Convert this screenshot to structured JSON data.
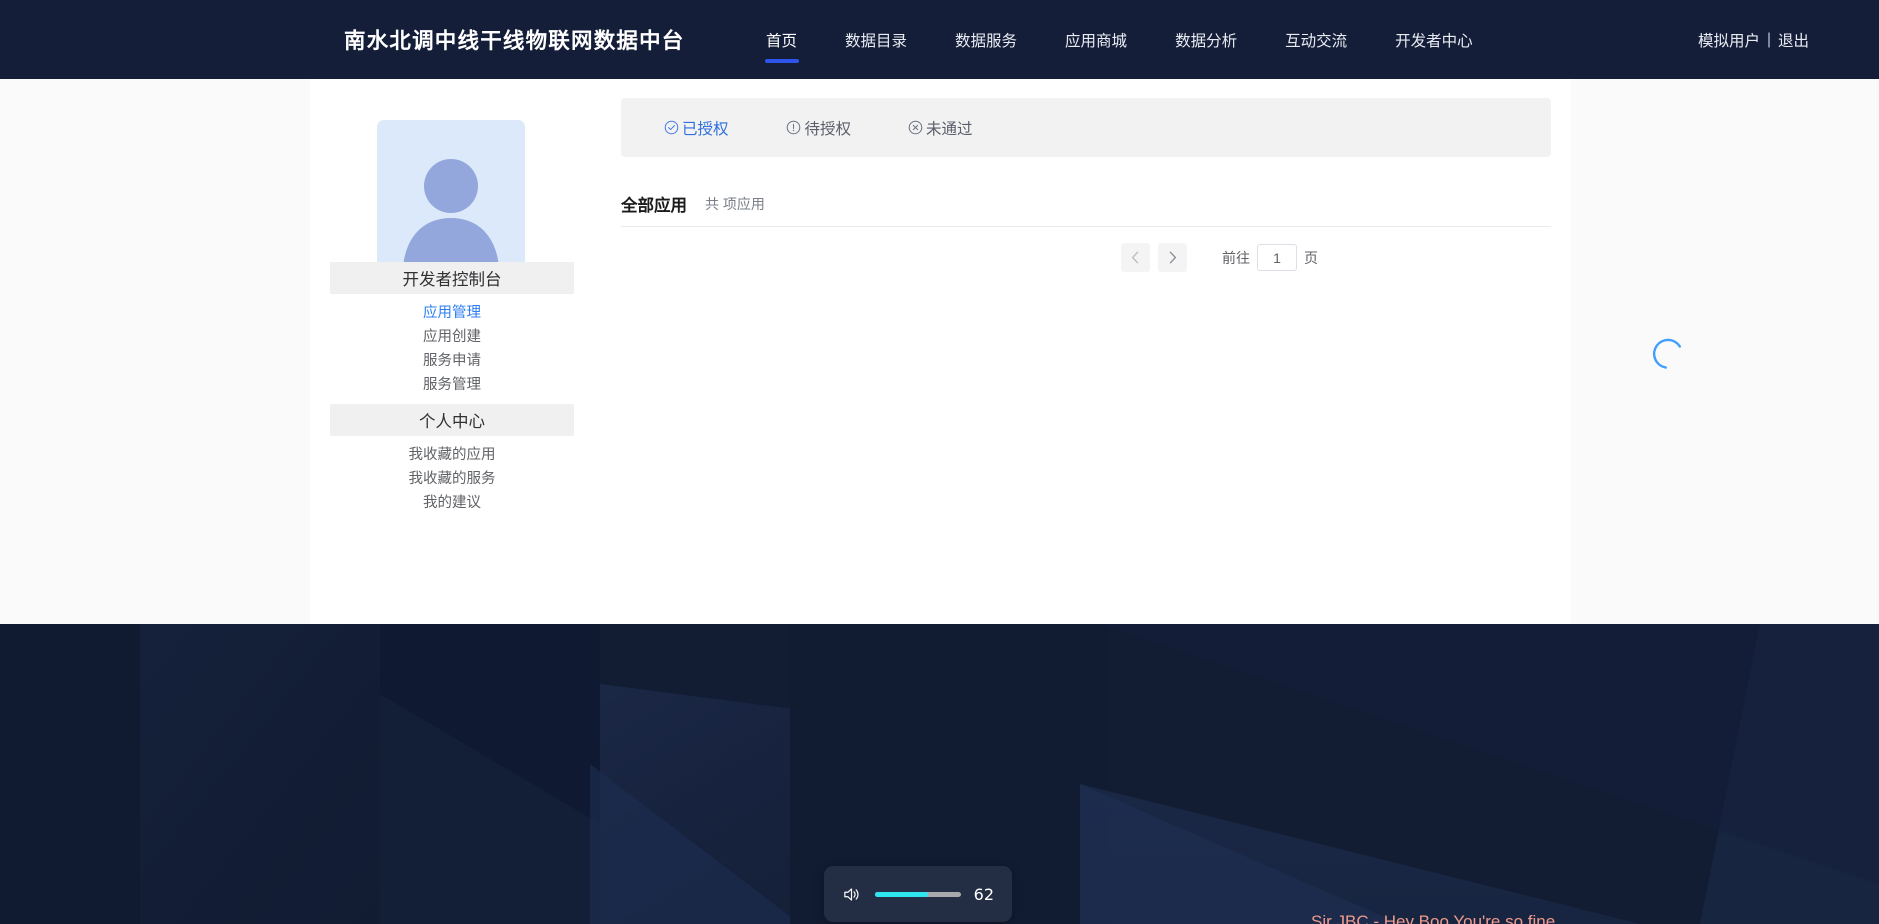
{
  "header": {
    "brand_title": "南水北调中线干线物联网数据中台",
    "nav_items": [
      {
        "label": "首页",
        "active": true
      },
      {
        "label": "数据目录",
        "active": false
      },
      {
        "label": "数据服务",
        "active": false
      },
      {
        "label": "应用商城",
        "active": false
      },
      {
        "label": "数据分析",
        "active": false
      },
      {
        "label": "互动交流",
        "active": false
      },
      {
        "label": "开发者中心",
        "active": false
      }
    ],
    "user_name": "模拟用户",
    "separator": "|",
    "logout_label": "退出"
  },
  "sidebar": {
    "avatar_icon": "user-avatar-icon",
    "groups": [
      {
        "heading": "开发者控制台",
        "items": [
          {
            "label": "应用管理",
            "active": true
          },
          {
            "label": "应用创建",
            "active": false
          },
          {
            "label": "服务申请",
            "active": false
          },
          {
            "label": "服务管理",
            "active": false
          }
        ]
      },
      {
        "heading": "个人中心",
        "items": [
          {
            "label": "我收藏的应用",
            "active": false
          },
          {
            "label": "我收藏的服务",
            "active": false
          },
          {
            "label": "我的建议",
            "active": false
          }
        ]
      }
    ]
  },
  "main": {
    "tabs": [
      {
        "label": "已授权",
        "icon": "check-circle-icon",
        "active": true
      },
      {
        "label": "待授权",
        "icon": "exclamation-circle-icon",
        "active": false
      },
      {
        "label": "未通过",
        "icon": "close-circle-icon",
        "active": false
      }
    ],
    "list_title": "全部应用",
    "count_text": "共 项应用",
    "loading": true,
    "pagination": {
      "prev_icon": "chevron-left-icon",
      "next_icon": "chevron-right-icon",
      "jump_prefix": "前往",
      "page_value": "1",
      "jump_suffix": "页"
    }
  },
  "volume_osd": {
    "icon": "speaker-volume-icon",
    "value": "62",
    "percent": 62
  },
  "now_playing": "Sir JBC - Hey Boo You're so fine",
  "colors": {
    "topbar_bg": "#141e38",
    "accent_blue": "#2f54eb",
    "link_blue": "#2b7df6",
    "tab_active": "#2f6fe0",
    "volume_fill": "#2ee6f0",
    "wallpaper_bg": "#121c33",
    "now_playing_text": "#f09a8c"
  }
}
